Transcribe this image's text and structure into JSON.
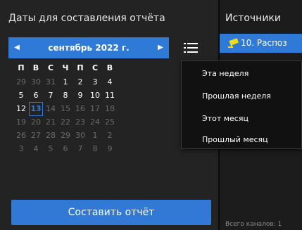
{
  "dates_panel": {
    "title": "Даты для составления отчёта",
    "month_label": "сентябрь 2022 г.",
    "prev_symbol": "◀",
    "next_symbol": "▶",
    "weekdays": [
      "П",
      "В",
      "С",
      "Ч",
      "П",
      "С",
      "В"
    ],
    "weeks": [
      [
        "29",
        "30",
        "31",
        "1",
        "2",
        "3",
        "4"
      ],
      [
        "5",
        "6",
        "7",
        "8",
        "9",
        "10",
        "11"
      ],
      [
        "12",
        "13",
        "14",
        "15",
        "16",
        "17",
        "18"
      ],
      [
        "19",
        "20",
        "21",
        "22",
        "23",
        "24",
        "25"
      ],
      [
        "26",
        "27",
        "28",
        "29",
        "30",
        "1",
        "2"
      ],
      [
        "3",
        "4",
        "5",
        "6",
        "7",
        "8",
        "9"
      ]
    ],
    "today": "13",
    "make_report_label": "Составить отчёт"
  },
  "sources_panel": {
    "title": "Источники",
    "selected_item": "10. Распоз",
    "footer": "Всего каналов: 1"
  },
  "period_menu": {
    "items": [
      "Эта неделя",
      "Прошлая неделя",
      "Этот месяц",
      "Прошлый месяц"
    ]
  },
  "colors": {
    "accent": "#2f7ad6",
    "camera_icon": "#f2d91a"
  }
}
